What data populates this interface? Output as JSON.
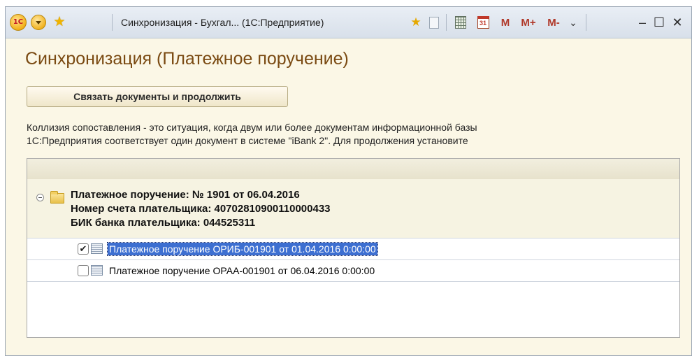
{
  "window": {
    "title": "Синхронизация - Бухгал... (1С:Предприятие)",
    "logo_text": "1С",
    "toolbar": {
      "m_label": "M",
      "m_plus_label": "M+",
      "m_minus_label": "M-",
      "calendar_day": "31"
    },
    "controls": {
      "dropdown": "⌄",
      "minimize": "–",
      "maximize": "☐",
      "close": "✕"
    }
  },
  "form": {
    "title": "Синхронизация (Платежное поручение)",
    "link_button_label": "Связать документы и продолжить",
    "description": [
      "Коллизия сопоставления - это ситуация, когда двум или более документам информационной базы",
      "1С:Предприятия соответствует один документ в системе \"iBank 2\". Для продолжения установите"
    ]
  },
  "tree": {
    "group": {
      "lines": [
        "Платежное поручение: № 1901 от 06.04.2016",
        "Номер счета плательщика: 40702810900110000433",
        "БИК банка плательщика: 044525311"
      ]
    },
    "items": [
      {
        "checked": true,
        "mark": "✔",
        "label": "Платежное поручение ОРИБ-001901 от 01.04.2016 0:00:00",
        "selected": true
      },
      {
        "checked": false,
        "mark": "",
        "label": "Платежное поручение ОРАА-001901 от 06.04.2016 0:00:00",
        "selected": false
      }
    ]
  },
  "colors": {
    "title_accent": "#7a4a12",
    "selection": "#3d6fd1",
    "panel_bg": "#fbf7e6"
  }
}
